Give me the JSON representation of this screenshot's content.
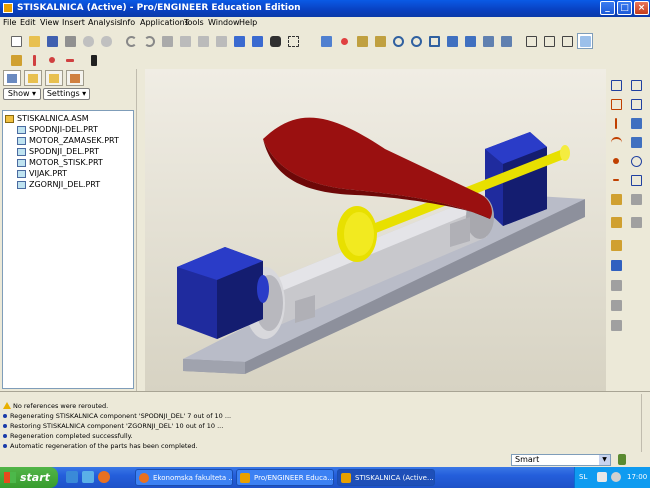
{
  "window": {
    "title": "STISKALNICA (Active) - Pro/ENGINEER Education Edition",
    "minimize": "_",
    "maximize": "□",
    "close": "×"
  },
  "menu": [
    "File",
    "Edit",
    "View",
    "Insert",
    "Analysis",
    "Info",
    "Applications",
    "Tools",
    "Window",
    "Help"
  ],
  "toolbar_icons": [
    "new-icon",
    "open-icon",
    "save-icon",
    "print-icon",
    "email-icon",
    "undo-icon",
    "redo-icon",
    "cut-icon",
    "copy-icon",
    "paste-icon",
    "regenerate-icon",
    "find-icon",
    "select-icon",
    "zoom-in-icon",
    "zoom-out-icon",
    "refit-icon",
    "orient-icon",
    "spin-icon",
    "view-manager-icon",
    "wireframe-icon",
    "hidden-line-icon",
    "no-hidden-icon",
    "shading-icon"
  ],
  "model_tree": {
    "show_label": "Show",
    "settings_label": "Settings",
    "items": [
      {
        "label": "STISKALNICA.ASM",
        "type": "asm"
      },
      {
        "label": "SPODNJI-DEL.PRT",
        "type": "prt"
      },
      {
        "label": "MOTOR_ZAMASEK.PRT",
        "type": "prt"
      },
      {
        "label": "SPODNJI_DEL.PRT",
        "type": "prt"
      },
      {
        "label": "MOTOR_STISK.PRT",
        "type": "prt"
      },
      {
        "label": "VIJAK.PRT",
        "type": "prt"
      },
      {
        "label": "ZGORNJI_DEL.PRT",
        "type": "prt"
      }
    ]
  },
  "messages": [
    {
      "kind": "warn",
      "text": "No references were rerouted."
    },
    {
      "kind": "info",
      "text": "Regenerating STISKALNICA component 'SPODNJI_DEL' 7 out of 10 ..."
    },
    {
      "kind": "info",
      "text": "Restoring STISKALNICA component 'ZGORNJI_DEL' 10 out of 10 ..."
    },
    {
      "kind": "info",
      "text": "Regeneration completed successfully."
    },
    {
      "kind": "info",
      "text": "Automatic regeneration of the parts has been completed."
    }
  ],
  "status": {
    "filter": "Smart"
  },
  "taskbar": {
    "start": "start",
    "tasks": [
      "Ekonomska fakulteta ...",
      "Pro/ENGINEER Educa...",
      "STISKALNICA (Active..."
    ],
    "tray_lang": "SL",
    "clock": "17:00"
  },
  "colors": {
    "base_plate": "#b9bcc8",
    "motor_block": "#1f2b9e",
    "cylinder": "#c8c8cc",
    "upper_shell": "#9a1010",
    "screw": "#e8e000"
  }
}
